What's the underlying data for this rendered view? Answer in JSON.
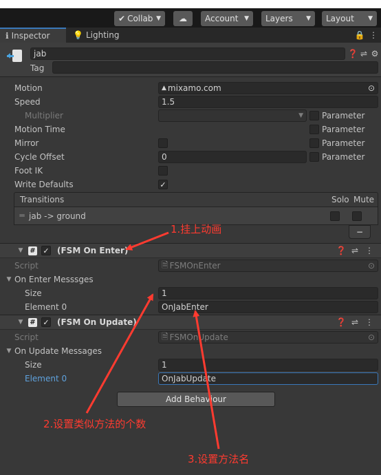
{
  "toolbar": {
    "collab": "Collab",
    "cloud_icon": "cloud-icon",
    "account": "Account",
    "layers": "Layers",
    "layout": "Layout"
  },
  "tabs": {
    "inspector": "Inspector",
    "lighting": "Lighting"
  },
  "object": {
    "name": "jab",
    "tag_label": "Tag",
    "tag_value": ""
  },
  "props": {
    "motion_label": "Motion",
    "motion_value": "mixamo.com",
    "speed_label": "Speed",
    "speed_value": "1.5",
    "multiplier_label": "Multiplier",
    "motion_time_label": "Motion Time",
    "mirror_label": "Mirror",
    "mirror_checked": false,
    "cycle_offset_label": "Cycle Offset",
    "cycle_offset_value": "0",
    "foot_ik_label": "Foot IK",
    "foot_ik_checked": false,
    "write_defaults_label": "Write Defaults",
    "write_defaults_checked": true,
    "parameter_label": "Parameter"
  },
  "transitions": {
    "header": "Transitions",
    "solo": "Solo",
    "mute": "Mute",
    "item": "jab -> ground",
    "remove_label": "−"
  },
  "fsm_enter": {
    "title": "(FSM On Enter)",
    "script_label": "Script",
    "script_value": "FSMOnEnter",
    "list_label": "On Enter Messsges",
    "size_label": "Size",
    "size_value": "1",
    "element_label": "Element 0",
    "element_value": "OnJabEnter"
  },
  "fsm_update": {
    "title": "(FSM On Update)",
    "script_label": "Script",
    "script_value": "FSMOnUpdate",
    "list_label": "On Update Messages",
    "size_label": "Size",
    "size_value": "1",
    "element_label": "Element 0",
    "element_value": "OnJabUpdate"
  },
  "add_behaviour": "Add Behaviour",
  "annotations": {
    "a1": "1.挂上动画",
    "a2": "2.设置类似方法的个数",
    "a3": "3.设置方法名"
  },
  "colors": {
    "accent": "#3a79bb",
    "annotation": "#ff3b30",
    "panel": "#383838"
  }
}
